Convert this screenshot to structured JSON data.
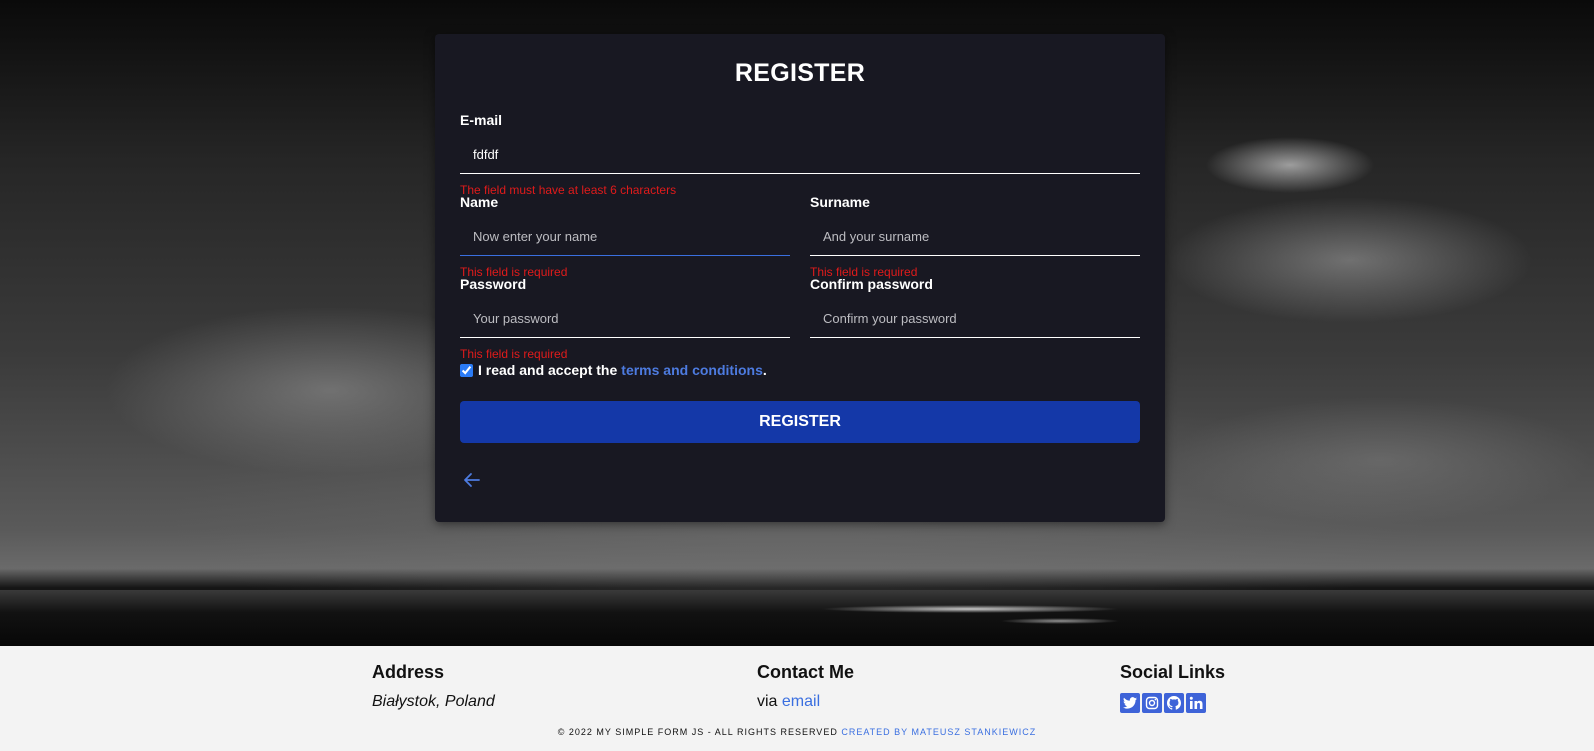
{
  "form": {
    "title": "REGISTER",
    "email": {
      "label": "E-mail",
      "value": "fdfdf",
      "placeholder": "",
      "error": "The field must have at least 6 characters"
    },
    "name": {
      "label": "Name",
      "value": "",
      "placeholder": "Now enter your name",
      "error": "This field is required"
    },
    "surname": {
      "label": "Surname",
      "value": "",
      "placeholder": "And your surname",
      "error": "This field is required"
    },
    "password": {
      "label": "Password",
      "value": "",
      "placeholder": "Your password",
      "error": "This field is required"
    },
    "confirm_password": {
      "label": "Confirm password",
      "value": "",
      "placeholder": "Confirm your password",
      "error": ""
    },
    "terms": {
      "checked": true,
      "text": "I read and accept the ",
      "link": "terms and conditions",
      "suffix": "."
    },
    "submit_label": "REGISTER",
    "back_icon": "arrow-left-icon"
  },
  "footer": {
    "address": {
      "heading": "Address",
      "text": "Białystok, Poland"
    },
    "contact": {
      "heading": "Contact Me",
      "prefix": "via ",
      "link": "email"
    },
    "social": {
      "heading": "Social Links",
      "icons": [
        "twitter-icon",
        "instagram-icon",
        "github-icon",
        "linkedin-icon"
      ]
    },
    "copyright": "© 2022 MY SIMPLE FORM JS - ALL RIGHTS RESERVED",
    "credit": "CREATED BY MATEUSZ STANKIEWICZ"
  },
  "colors": {
    "card_bg": "#181822",
    "accent": "#1438a8",
    "link": "#4d7be0",
    "error": "#e01b1b"
  }
}
